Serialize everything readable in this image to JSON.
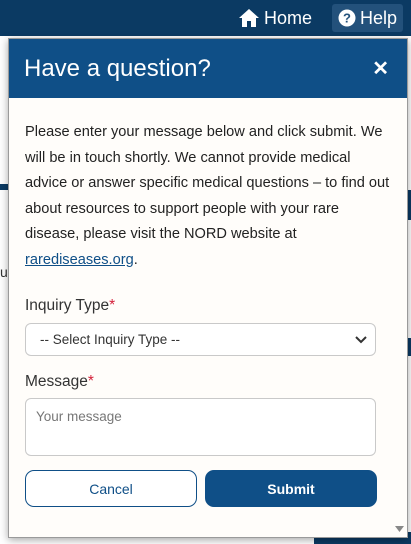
{
  "background": {
    "nav": {
      "home_label": "Home",
      "help_label": "Help"
    },
    "fragment_text": "u"
  },
  "modal": {
    "title": "Have a question?",
    "close_symbol": "✕",
    "intro_text": "Please enter your message below and click submit. We will be in touch shortly. We cannot provide medical advice or answer specific medical questions – to find out about resources to support people with your rare disease, please visit the NORD website at ",
    "intro_link": "rarediseases.org",
    "intro_end": ".",
    "inquiry": {
      "label": "Inquiry Type",
      "required_mark": "*",
      "selected": "-- Select Inquiry Type --"
    },
    "message": {
      "label": "Message",
      "required_mark": "*",
      "placeholder": "Your message"
    },
    "buttons": {
      "cancel": "Cancel",
      "submit": "Submit"
    }
  },
  "colors": {
    "brand": "#0f4f87",
    "required": "#d4203a"
  }
}
